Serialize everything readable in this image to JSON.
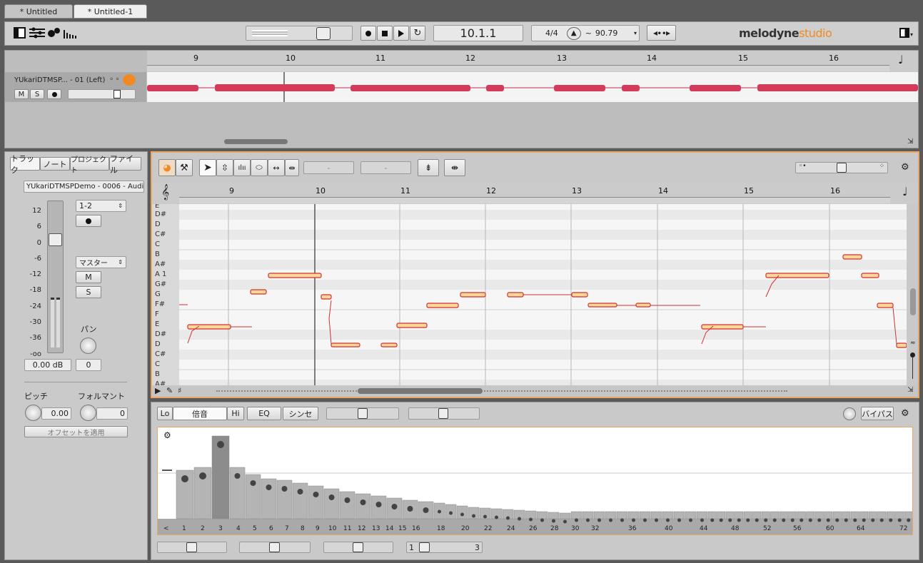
{
  "tabs": [
    {
      "label": "* Untitled"
    },
    {
      "label": "* Untitled-1"
    }
  ],
  "transport": {
    "position": "10.1.1",
    "time_signature": "4/4",
    "tempo_prefix": "~",
    "tempo": "90.79"
  },
  "brand": {
    "name": "melodyne",
    "edition": "studio"
  },
  "track": {
    "name": "YUkariDTMSP... - 01 (Left)",
    "mute": "M",
    "solo": "S"
  },
  "top_ruler": [
    "9",
    "10",
    "11",
    "12",
    "13",
    "14",
    "15",
    "16"
  ],
  "inspector": {
    "tabs": [
      "トラック",
      "ノート",
      "プロジェクト",
      "ファイル"
    ],
    "source": "YUkariDTMSPDemo - 0006 - Audio -",
    "meter_scale": [
      "12",
      "6",
      "0",
      "-6",
      "-12",
      "-18",
      "-24",
      "-30",
      "-36",
      "-oo"
    ],
    "input": "1-2",
    "output": "マスター",
    "mute": "M",
    "solo": "S",
    "pan_label": "パン",
    "gain": "0.00 dB",
    "pan_value": "0",
    "pitch_label": "ピッチ",
    "formant_label": "フォルマント",
    "pitch_value": "0.00",
    "formant_value": "0",
    "apply_offset": "オフセットを適用"
  },
  "editor": {
    "field1": "-",
    "field2": "-",
    "ruler": [
      "9",
      "10",
      "11",
      "12",
      "13",
      "14",
      "15",
      "16"
    ],
    "pitch_labels": [
      "E",
      "D#",
      "D",
      "C#",
      "C",
      "B",
      "A#",
      "A 1",
      "G#",
      "G",
      "F#",
      "F",
      "E",
      "D#",
      "D",
      "C#",
      "C",
      "B",
      "A#"
    ]
  },
  "sound_editor": {
    "tabs": [
      "Lo",
      "倍音",
      "Hi",
      "EQ",
      "シンセ"
    ],
    "bypass": "バイパス",
    "harmonic_labels": [
      "<",
      "1",
      "2",
      "3",
      "4",
      "5",
      "6",
      "7",
      "8",
      "9",
      "10",
      "11",
      "12",
      "13",
      "14",
      "15",
      "16",
      "18",
      "20",
      "22",
      "24",
      "26",
      "28",
      "30",
      "32",
      "36",
      "40",
      "44",
      "48",
      "52",
      "56",
      "60",
      "64",
      "72"
    ],
    "page_start": "1",
    "page_end": "3"
  },
  "colors": {
    "accent": "#f08a24",
    "blob": "#d43a5a",
    "note_fill": "#ffd79a",
    "note_border": "#d03030"
  }
}
